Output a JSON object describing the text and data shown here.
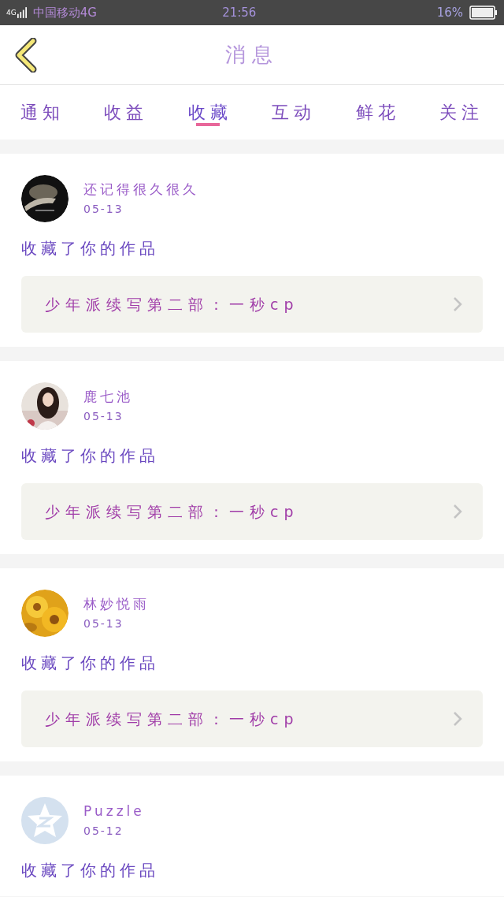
{
  "status_bar": {
    "network": "4G",
    "carrier": "中国移动4G",
    "time": "21:56",
    "battery": "16%"
  },
  "header": {
    "title": "消息"
  },
  "tabs": [
    {
      "label": "通知",
      "selected": false
    },
    {
      "label": "收益",
      "selected": false
    },
    {
      "label": "收藏",
      "selected": true
    },
    {
      "label": "互动",
      "selected": false
    },
    {
      "label": "鲜花",
      "selected": false
    },
    {
      "label": "关注",
      "selected": false
    }
  ],
  "messages": [
    {
      "name": "还记得很久很久",
      "date": "05-13",
      "action": "收藏了你的作品",
      "work": "少年派续写第二部：一秒cp"
    },
    {
      "name": "鹿七池",
      "date": "05-13",
      "action": "收藏了你的作品",
      "work": "少年派续写第二部：一秒cp"
    },
    {
      "name": "林妙悦雨",
      "date": "05-13",
      "action": "收藏了你的作品",
      "work": "少年派续写第二部：一秒cp"
    },
    {
      "avatar": {
        "kind": "default"
      },
      "name": "Puzzle",
      "date": "05-12",
      "action": "收藏了你的作品"
    }
  ]
}
